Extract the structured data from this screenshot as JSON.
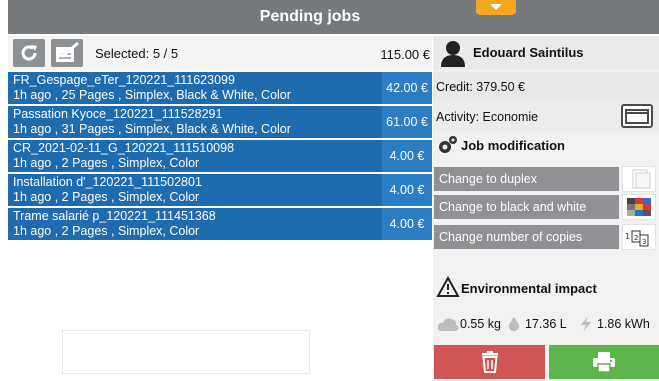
{
  "header": {
    "title": "Pending jobs"
  },
  "toolbar": {
    "selected_label": "Selected: 5 / 5",
    "total": "115.00 €"
  },
  "jobs": [
    {
      "name": "FR_Gespage_eTer_120221_111623099",
      "meta": "1h ago , 25 Pages , Simplex, Black & White, Color",
      "price": "42.00 €"
    },
    {
      "name": "Passation Kyoce_120221_111528291",
      "meta": "1h ago , 31 Pages , Simplex, Black & White, Color",
      "price": "61.00 €"
    },
    {
      "name": "CR_2021-02-11_G_120221_111510098",
      "meta": "1h ago , 2 Pages , Simplex, Color",
      "price": "4.00 €"
    },
    {
      "name": "Installation d'_120221_111502801",
      "meta": "1h ago , 2 Pages , Simplex, Color",
      "price": "4.00 €"
    },
    {
      "name": "Trame salarié p_120221_111451368",
      "meta": "1h ago , 2 Pages , Simplex, Color",
      "price": "4.00 €"
    }
  ],
  "user": {
    "name": "Edouard Saintilus",
    "credit": "Credit: 379.50 €",
    "activity": "Activity: Economie"
  },
  "job_modification": {
    "title": "Job modification",
    "duplex": "Change to duplex",
    "bw": "Change to black and white",
    "copies": "Change number of copies"
  },
  "environment": {
    "title": "Environmental impact",
    "co2": "0.55 kg",
    "water": "17.36 L",
    "energy": "1.86 kWh"
  },
  "colors": {
    "header_bg": "#777a7d",
    "job_bg": "#1f6bb0",
    "price_bg": "#2c7ec4",
    "accent_tab": "#f3a621",
    "delete": "#d05555",
    "print": "#5cb54a",
    "mod_button": "#8f9194"
  }
}
